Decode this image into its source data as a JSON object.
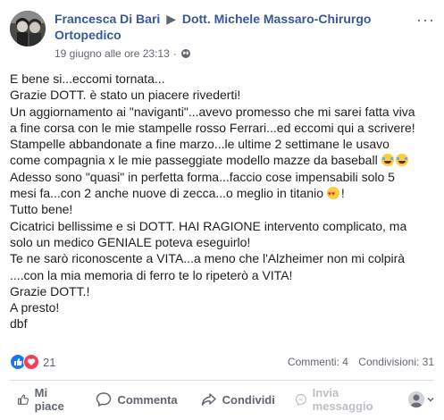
{
  "post": {
    "author": "Francesca Di Bari",
    "separator": "▶",
    "recipient": "Dott. Michele Massaro-Chirurgo Ortopedico",
    "timestamp": "19 giugno alle ore 23:13",
    "privacy_icon": "globe-icon",
    "more_label": "···"
  },
  "body": {
    "lines": [
      "E bene si...eccomi tornata...",
      "Grazie DOTT. è stato un piacere rivederti!",
      "Un aggiornamento ai \"naviganti\"...avevo promesso che mi sarei fatta viva",
      "a fine corsa con le mie stampelle rosso Ferrari...ed eccomi qui a scrivere!",
      "Stampelle abbandonate a fine marzo...le ultime 2 settimane le usavo",
      "come compagnia x le mie passeggiate modello mazze da baseball",
      "Adesso sono \"quasi\" in perfetta forma...faccio cose impensabili solo 5",
      "mesi fa...con 2 anche nuove di zecca...o meglio in titanio",
      "Tutto bene!",
      "Cicatrici bellissime e si DOTT. HAI RAGIONE intervento complicato, ma",
      "solo un medico GENIALE poteva eseguirlo!",
      "Te ne sarò riconoscente a VITA...a meno che l'Alzheimer non mi colpirà",
      "....con la mia memoria di ferro te lo ripeterò a VITA!",
      "Grazie DOTT.!",
      "A presto!",
      "dbf"
    ],
    "line_suffix": "!"
  },
  "stats": {
    "reaction_count": "21",
    "comments": "Commenti: 4",
    "shares": "Condivisioni: 31"
  },
  "actions": {
    "like": "Mi piace",
    "comment": "Commenta",
    "share": "Condividi",
    "message": "Invia messaggio"
  },
  "colors": {
    "link": "#385898",
    "secondary": "#606770",
    "like_blue": "#1877f2",
    "love_red": "#f33e58"
  }
}
